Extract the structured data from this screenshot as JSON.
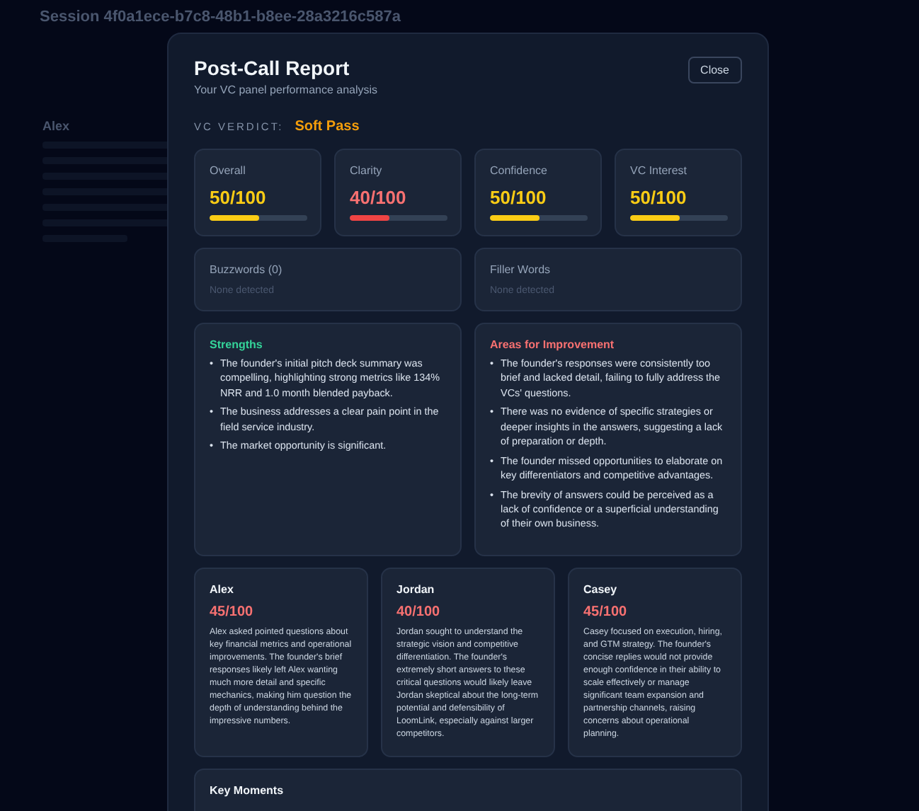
{
  "page": {
    "title": "Session 4f0a1ece-b7c8-48b1-b8ee-28a3216c587a",
    "section_heading": "Alex"
  },
  "modal": {
    "bullet": "•",
    "title": "Post-Call Report",
    "subtitle": "Your VC panel performance analysis",
    "close_label": "Close",
    "verdict": {
      "label": "VC VERDICT:",
      "value": "Soft Pass"
    },
    "metrics": [
      {
        "label": "Overall",
        "score": "50/100",
        "level": 0.5
      },
      {
        "label": "Clarity",
        "score": "40/100",
        "level": 0.4
      },
      {
        "label": "Confidence",
        "score": "50/100",
        "level": 0.5
      },
      {
        "label": "VC Interest",
        "score": "50/100",
        "level": 0.5
      }
    ],
    "word_checks": [
      {
        "label": "Buzzwords (0)",
        "value": "None detected"
      },
      {
        "label": "Filler Words",
        "value": "None detected"
      }
    ],
    "strengths": {
      "title": "Strengths",
      "items": [
        "The founder's initial pitch deck summary was compelling, highlighting strong metrics like 134% NRR and 1.0 month blended payback.",
        "The business addresses a clear pain point in the field service industry.",
        "The market opportunity is significant."
      ]
    },
    "improvements": {
      "title": "Areas for Improvement",
      "items": [
        "The founder's responses were consistently too brief and lacked detail, failing to fully address the VCs' questions.",
        "There was no evidence of specific strategies or deeper insights in the answers, suggesting a lack of preparation or depth.",
        "The founder missed opportunities to elaborate on key differentiators and competitive advantages.",
        "The brevity of answers could be perceived as a lack of confidence or a superficial understanding of their own business."
      ]
    },
    "panelists": [
      {
        "name": "Alex",
        "score": "45/100",
        "summary": "Alex asked pointed questions about key financial metrics and operational improvements. The founder's brief responses likely left Alex wanting much more detail and specific mechanics, making him question the depth of understanding behind the impressive numbers."
      },
      {
        "name": "Jordan",
        "score": "40/100",
        "summary": "Jordan sought to understand the strategic vision and competitive differentiation. The founder's extremely short answers to these critical questions would likely leave Jordan skeptical about the long-term potential and defensibility of LoomLink, especially against larger competitors."
      },
      {
        "name": "Casey",
        "score": "45/100",
        "summary": "Casey focused on execution, hiring, and GTM strategy. The founder's concise replies would not provide enough confidence in their ability to scale effectively or manage significant team expansion and partnership channels, raising concerns about operational planning."
      }
    ],
    "key_moments": {
      "title": "Key Moments"
    }
  }
}
